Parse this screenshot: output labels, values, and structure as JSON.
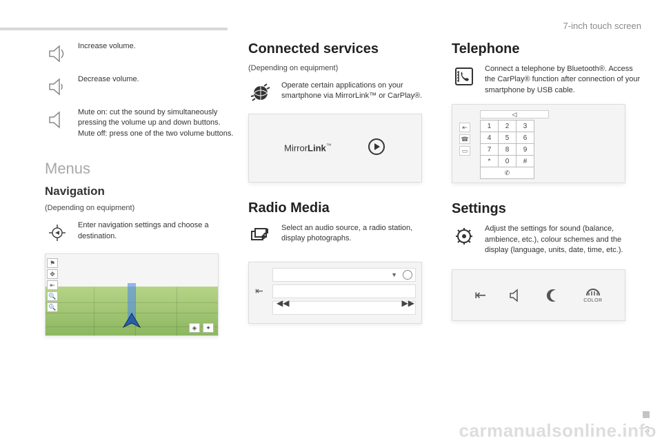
{
  "header": {
    "section": "7-inch touch screen"
  },
  "page": {
    "number": "3",
    "watermark": "carmanualsonline.info"
  },
  "col1": {
    "volume_up": "Increase volume.",
    "volume_down": "Decrease volume.",
    "mute": "Mute on: cut the sound by simultaneously pressing the volume up and down buttons.\nMute off: press one of the two volume buttons.",
    "menus_title": "Menus",
    "nav_title": "Navigation",
    "depending": "(Depending on equipment)",
    "nav_text": "Enter navigation settings and choose a destination."
  },
  "col2": {
    "connected_title": "Connected services",
    "depending": "(Depending on equipment)",
    "connected_text": "Operate certain applications on your smartphone via MirrorLink™ or CarPlay®.",
    "mirrorlink_label": "MirrorLink",
    "radio_title": "Radio Media",
    "radio_text": "Select an audio source, a radio station, display photographs."
  },
  "col3": {
    "tel_title": "Telephone",
    "tel_text": "Connect a telephone by Bluetooth®. Access the CarPlay® function after connection of your smartphone by USB cable.",
    "keypad": [
      [
        "1",
        "2",
        "3"
      ],
      [
        "4",
        "5",
        "6"
      ],
      [
        "7",
        "8",
        "9"
      ],
      [
        "*",
        "0",
        "#"
      ]
    ],
    "settings_title": "Settings",
    "settings_text": "Adjust the settings for sound (balance, ambience, etc.), colour schemes and the display (language, units, date, time, etc.).",
    "color_label": "COLOR"
  }
}
